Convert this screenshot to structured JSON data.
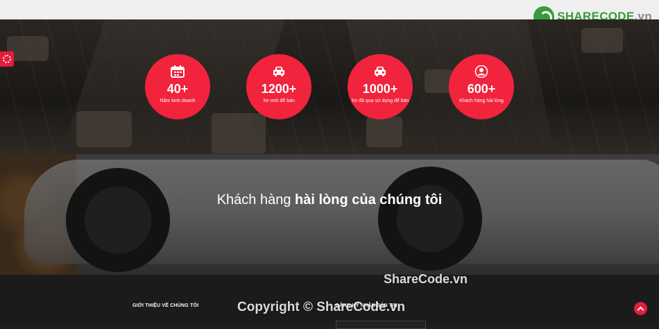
{
  "brand": {
    "logo_main": "SHARECODE",
    "logo_suffix": ".vn"
  },
  "stats": [
    {
      "icon": "calendar-icon",
      "number": "40+",
      "label": "Năm kinh doanh"
    },
    {
      "icon": "car-icon",
      "number": "1200+",
      "label": "Xe mới để bán"
    },
    {
      "icon": "car-icon",
      "number": "1000+",
      "label": "Xe đã qua sử dụng để bán"
    },
    {
      "icon": "user-icon",
      "number": "600+",
      "label": "Khách hàng hài lòng"
    }
  ],
  "banner": {
    "title_normal": "Khách hàng ",
    "title_bold": "hài lòng của chúng tôi"
  },
  "footer": {
    "about_heading": "GIỚI THIỆU VỀ CHÚNG TÔI",
    "newsletter_heading": "ĐĂNG KÝ NHẬN BẢN TIN"
  },
  "watermarks": {
    "center": "ShareCode.vn",
    "copyright": "Copyright © ShareCode.vn"
  },
  "colors": {
    "accent": "#f2233c",
    "brand_green": "#3a9b3a"
  }
}
